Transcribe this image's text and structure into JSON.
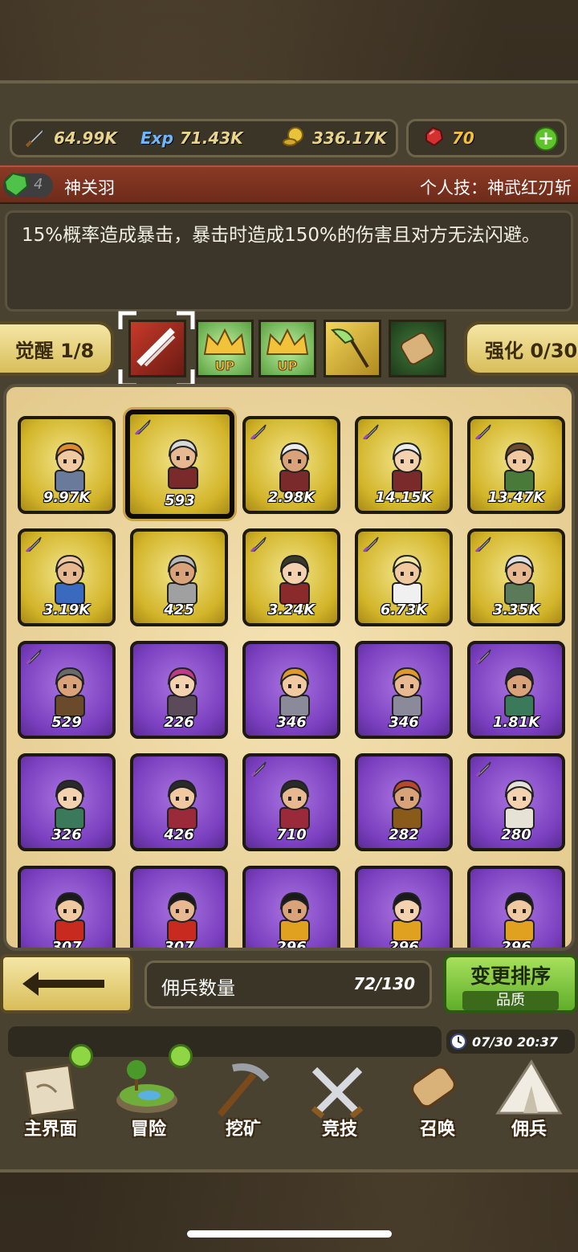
{
  "resources": {
    "attack": "64.99K",
    "exp_label": "Exp",
    "exp": "71.43K",
    "gold": "336.17K",
    "gems": "70"
  },
  "hero": {
    "rank": "4",
    "name": "神关羽",
    "skill_label": "个人技：神武红刃斩",
    "description": "15%概率造成暴击，暴击时造成150%的伤害且对方无法闪避。"
  },
  "controls": {
    "awaken": "觉醒 1/8",
    "enhance": "强化 0/30",
    "skills": [
      "sword-slash-icon",
      "crown-up-icon",
      "crown-up-icon",
      "guandao-icon",
      "scroll-icon"
    ],
    "up_label": "UP"
  },
  "cards": [
    {
      "value": "9.97K",
      "rarity": "gold",
      "badge": ""
    },
    {
      "value": "593",
      "rarity": "gold",
      "badge": "sword",
      "selected": true
    },
    {
      "value": "2.98K",
      "rarity": "gold",
      "badge": "sword"
    },
    {
      "value": "14.15K",
      "rarity": "gold",
      "badge": "sword"
    },
    {
      "value": "13.47K",
      "rarity": "gold",
      "badge": "sword"
    },
    {
      "value": "3.19K",
      "rarity": "gold",
      "badge": "sword"
    },
    {
      "value": "425",
      "rarity": "gold",
      "badge": ""
    },
    {
      "value": "3.24K",
      "rarity": "gold",
      "badge": "sword"
    },
    {
      "value": "6.73K",
      "rarity": "gold",
      "badge": "sword"
    },
    {
      "value": "3.35K",
      "rarity": "gold",
      "badge": "sword"
    },
    {
      "value": "529",
      "rarity": "purple",
      "badge": "sword"
    },
    {
      "value": "226",
      "rarity": "purple",
      "badge": ""
    },
    {
      "value": "346",
      "rarity": "purple",
      "badge": ""
    },
    {
      "value": "346",
      "rarity": "purple",
      "badge": ""
    },
    {
      "value": "1.81K",
      "rarity": "purple",
      "badge": "sword"
    },
    {
      "value": "326",
      "rarity": "purple",
      "badge": ""
    },
    {
      "value": "426",
      "rarity": "purple",
      "badge": ""
    },
    {
      "value": "710",
      "rarity": "purple",
      "badge": "sword"
    },
    {
      "value": "282",
      "rarity": "purple",
      "badge": ""
    },
    {
      "value": "280",
      "rarity": "purple",
      "badge": "sword"
    },
    {
      "value": "307",
      "rarity": "purple",
      "badge": ""
    },
    {
      "value": "307",
      "rarity": "purple",
      "badge": ""
    },
    {
      "value": "296",
      "rarity": "purple",
      "badge": ""
    },
    {
      "value": "296",
      "rarity": "purple",
      "badge": ""
    },
    {
      "value": "296",
      "rarity": "purple",
      "badge": ""
    }
  ],
  "footer": {
    "count_label": "佣兵数量",
    "count_value": "72/130",
    "sort_label": "变更排序",
    "sort_sub": "品质",
    "clock": "07/30 20:37"
  },
  "nav": [
    "主界面",
    "冒险",
    "挖矿",
    "竞技",
    "召唤",
    "佣兵"
  ],
  "colors": {
    "gold_card": "#d3b52a",
    "purple_card": "#7a3fbf",
    "accent_green": "#5fc42c",
    "name_bar": "#8a3a24"
  }
}
